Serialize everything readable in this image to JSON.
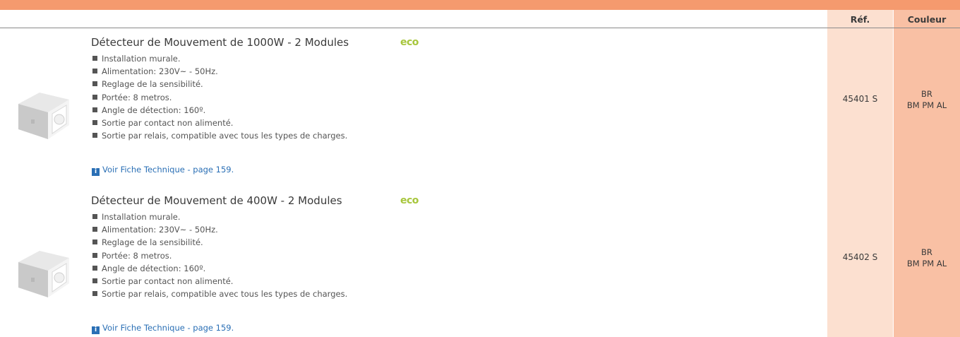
{
  "table": {
    "headers": {
      "ref": "Réf.",
      "color": "Couleur"
    }
  },
  "products": [
    {
      "title": "Détecteur de Mouvement de 1000W - 2 Modules",
      "eco": "eco",
      "features": [
        "Installation murale.",
        "Alimentation: 230V~ - 50Hz.",
        "Reglage de la sensibilité.",
        "Portée: 8 metros.",
        "Angle de détection: 160º.",
        "Sortie par contact non alimenté.",
        "Sortie par relais, compatible avec tous les types de charges."
      ],
      "tech_link": "Voir Fiche Technique - page 159.",
      "ref": "45401 S",
      "color_line1": "BR",
      "color_line2": "BM PM AL"
    },
    {
      "title": "Détecteur de Mouvement de 400W - 2 Modules",
      "eco": "eco",
      "features": [
        "Installation murale.",
        "Alimentation: 230V~ - 50Hz.",
        "Reglage de la sensibilité.",
        "Portée: 8 metros.",
        "Angle de détection: 160º.",
        "Sortie par contact non alimenté.",
        "Sortie par relais, compatible avec tous les types de charges."
      ],
      "tech_link": "Voir Fiche Technique - page 159.",
      "ref": "45402 S",
      "color_line1": "BR",
      "color_line2": "BM PM AL"
    }
  ],
  "colors": {
    "top_band": "#f59a6e",
    "ref_column": "#fce0d0",
    "color_column": "#f9c0a4",
    "eco": "#a7c63c",
    "link": "#2a6fb5"
  }
}
